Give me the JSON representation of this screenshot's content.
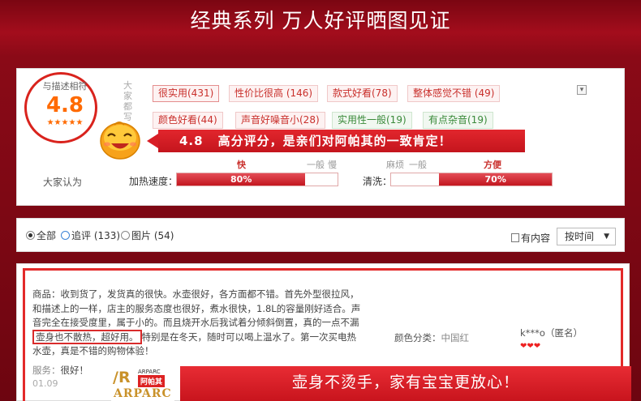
{
  "header": {
    "title": "经典系列 万人好评晒图见证"
  },
  "rating": {
    "label": "与描述相符",
    "score": "4.8",
    "stars": "★★★★★"
  },
  "tags_section": {
    "vertical_label": "大家都写",
    "tags": [
      {
        "label": "很实用(431)",
        "kind": "pos"
      },
      {
        "label": "性价比很高 (146)",
        "kind": "pos"
      },
      {
        "label": "款式好看(78)",
        "kind": "pos"
      },
      {
        "label": "整体感觉不错 (49)",
        "kind": "pos"
      },
      {
        "label": "颜色好看(44)",
        "kind": "pos"
      },
      {
        "label": "声音好噪音小(28)",
        "kind": "pos"
      },
      {
        "label": "实用性一般(19)",
        "kind": "neu"
      },
      {
        "label": "有点杂音(19)",
        "kind": "neu"
      }
    ],
    "expand_icon": "▾"
  },
  "banner": {
    "score": "4.8",
    "text": "高分评分，是亲们对阿帕其的一致肯定！",
    "icon": "smiling-face-icon"
  },
  "metrics": {
    "people_think": "大家认为",
    "heating": {
      "label": "加热速度：",
      "high": "快",
      "mid": "一般",
      "low": "慢",
      "value_label": "80%",
      "value": 0.8
    },
    "cleaning": {
      "label": "清洗：",
      "low": "麻烦",
      "mid": "一般",
      "high": "方便",
      "value_label": "70%",
      "value": 0.7
    }
  },
  "filters": {
    "all": "全部",
    "followup": "追评 (133)",
    "images": "图片 (54)",
    "has_content": "有内容",
    "sort": "按时间",
    "sort_arrow": "▼"
  },
  "review": {
    "text_before": "商品：收到货了，发货真的很快。水壶很好，各方面都不错。首先外型很拉风，和描述上的一样，店主的服务态度也很好，煮水很快，1.8L的容量刚好适合。声音完全在接受度里，属于小的。而且烧开水后我试着分倾斜倒置，真的一点不漏",
    "highlight": "壶身也不散热，超好用。",
    "text_after": "特别是在冬天，随时可以喝上温水了。第一次买电热水壶，真是不错的购物体验！",
    "reply_label": "服务：",
    "reply_value": "很好！",
    "date": "01.09",
    "color_label": "颜色分类：",
    "color_value": "中国红",
    "user": "k***o（匿名）",
    "user_badge": "❤❤❤"
  },
  "logo": {
    "mark": "/R",
    "small": "ARPARC",
    "cn": "阿帕其",
    "en": "ARPARC"
  },
  "promo": {
    "text": "壶身不烫手，家有宝宝更放心！"
  },
  "colors": {
    "brand_red": "#c4151d",
    "orange": "#ff6a00"
  }
}
